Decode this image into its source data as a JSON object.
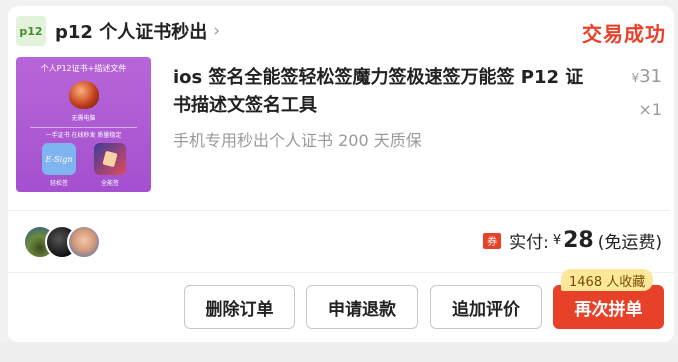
{
  "shop": {
    "avatar_text": "p12",
    "name": "p12 个人证书秒出",
    "chevron": "›",
    "status": "交易成功"
  },
  "product": {
    "title": "ios 签名全能签轻松签魔力签极速签万能签 P12 证书描述文签名工具",
    "description": "手机专用秒出个人证书 200 天质保",
    "price_currency": "¥",
    "price": "31",
    "quantity": "×1",
    "thumbnail": {
      "title": "个人P12证书+描述文件",
      "sub1": "无需电脑",
      "sub2": "一手证书  在线秒发  质量稳定",
      "app1_icon_text": "E-Sign",
      "app1_label": "轻松签",
      "app2_label": "全能签"
    }
  },
  "payment": {
    "coupon_icon": "券",
    "label": "实付:",
    "currency": "¥",
    "amount": "28",
    "note": "(免运费)"
  },
  "actions": {
    "delete": "删除订单",
    "refund": "申请退款",
    "review": "追加评价",
    "rebuy": "再次拼单",
    "favorites_badge": "1468 人收藏"
  },
  "colors": {
    "accent": "#e8412a",
    "badge_bg": "#fde79a",
    "thumb_bg": "#a450cf"
  }
}
